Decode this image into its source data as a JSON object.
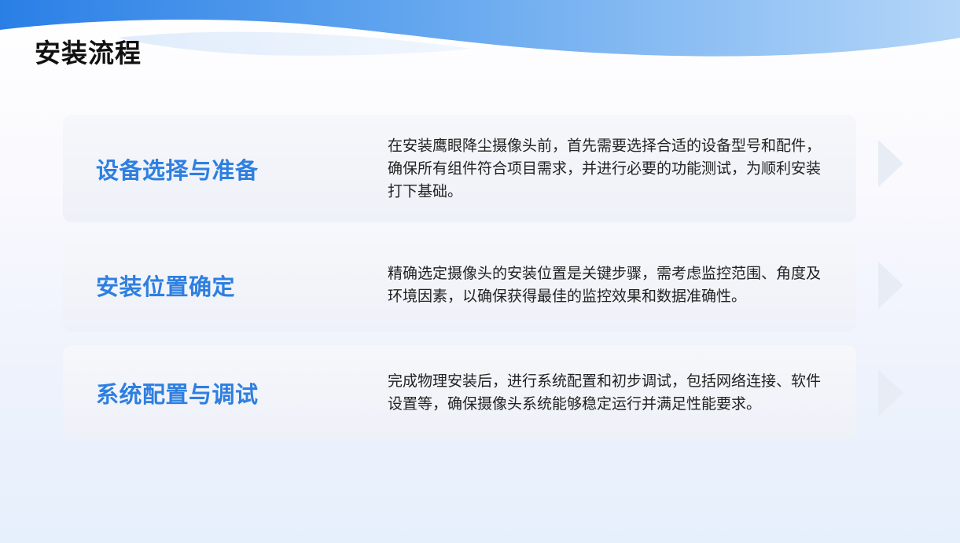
{
  "slide": {
    "title": "安装流程"
  },
  "steps": [
    {
      "heading": "设备选择与准备",
      "text": "在安装鹰眼降尘摄像头前，首先需要选择合适的设备型号和配件，确保所有组件符合项目需求，并进行必要的功能测试，为顺利安装打下基础。"
    },
    {
      "heading": "安装位置确定",
      "text": "精确选定摄像头的安装位置是关键步骤，需考虑监控范围、角度及环境因素，以确保获得最佳的监控效果和数据准确性。"
    },
    {
      "heading": "系统配置与调试",
      "text": "完成物理安装后，进行系统配置和初步调试，包括网络连接、软件设置等，确保摄像头系统能够稳定运行并满足性能要求。"
    }
  ],
  "colors": {
    "accent": "#2e7fe0",
    "wave_start": "#2a7fe6",
    "wave_end": "#b4d6f8",
    "title": "#111111",
    "body_text": "#222222"
  },
  "icons": {
    "step_arrow": "chevron-right-icon"
  }
}
